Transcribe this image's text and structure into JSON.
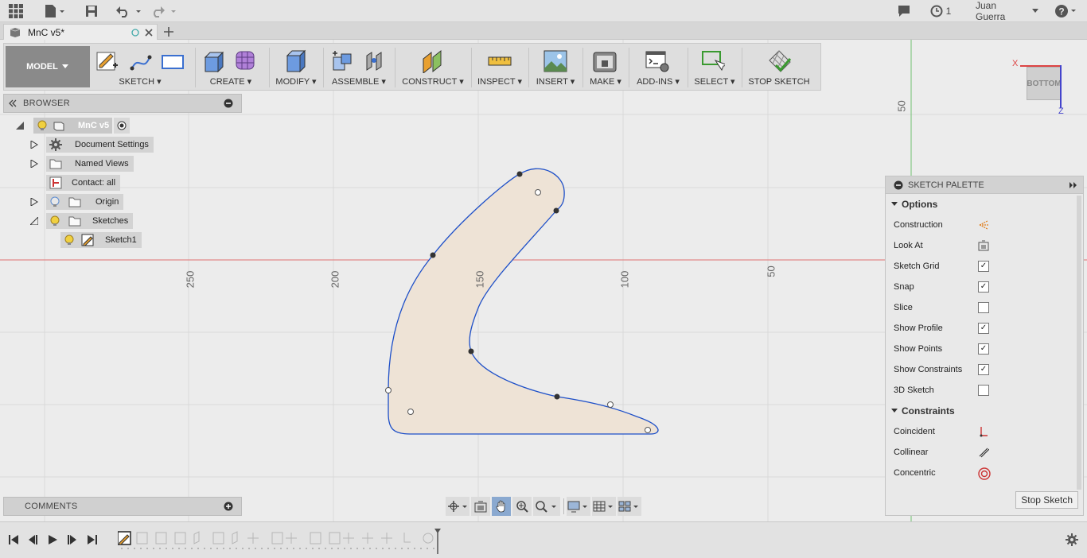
{
  "topbar": {
    "user": "Juan Guerra",
    "jobs_count": "1"
  },
  "tab": {
    "title": "MnC v5*"
  },
  "ribbon": {
    "workspace": "MODEL",
    "groups": [
      "SKETCH",
      "CREATE",
      "MODIFY",
      "ASSEMBLE",
      "CONSTRUCT",
      "INSPECT",
      "INSERT",
      "MAKE",
      "ADD-INS",
      "SELECT",
      "STOP SKETCH"
    ]
  },
  "browser": {
    "title": "BROWSER",
    "root": "MnC v5",
    "items": [
      "Document Settings",
      "Named Views",
      "Contact: all",
      "Origin",
      "Sketches",
      "Sketch1"
    ]
  },
  "comments": {
    "title": "COMMENTS"
  },
  "canvas": {
    "axis_labels": [
      "250",
      "200",
      "150",
      "100",
      "50",
      "50"
    ],
    "viewcube": {
      "face": "BOTTOM",
      "x": "X",
      "z": "Z"
    }
  },
  "palette": {
    "title": "SKETCH PALETTE",
    "options_title": "Options",
    "options": [
      {
        "label": "Construction",
        "type": "icon"
      },
      {
        "label": "Look At",
        "type": "icon"
      },
      {
        "label": "Sketch Grid",
        "type": "check",
        "checked": true
      },
      {
        "label": "Snap",
        "type": "check",
        "checked": true
      },
      {
        "label": "Slice",
        "type": "check",
        "checked": false
      },
      {
        "label": "Show Profile",
        "type": "check",
        "checked": true
      },
      {
        "label": "Show Points",
        "type": "check",
        "checked": true
      },
      {
        "label": "Show Constraints",
        "type": "check",
        "checked": true
      },
      {
        "label": "3D Sketch",
        "type": "check",
        "checked": false
      }
    ],
    "constraints_title": "Constraints",
    "constraints": [
      "Coincident",
      "Collinear",
      "Concentric"
    ],
    "stop_button": "Stop Sketch"
  }
}
